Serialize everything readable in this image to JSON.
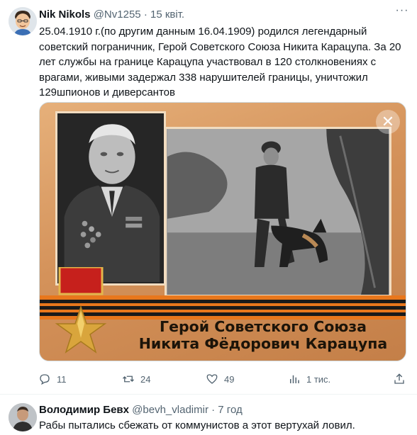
{
  "tweet": {
    "author_name": "Nik Nikols",
    "author_handle": "@Nv1255",
    "separator": "·",
    "date": "15 квіт.",
    "more_label": "···",
    "text": "25.04.1910 г.(по другим данным 16.04.1909) родился легендарный советский пограничник, Герой Советского Союза Никита Карацупа. За 20 лет службы на границе Карацупа участвовал в 120 столкновениях с врагами, живыми задержал 338 нарушителей границы, уничтожил 129шпионов и диверсантов",
    "image": {
      "caption_line1": "Герой Советского Союза",
      "caption_line2": "Никита Фёдорович Карацупа",
      "close_label": "✕"
    },
    "actions": {
      "replies": "11",
      "reposts": "24",
      "likes": "49",
      "views": "1 тис."
    }
  },
  "reply": {
    "author_name": "Володимир Бевх",
    "author_handle": "@bevh_vladimir",
    "separator": "·",
    "date": "7 год",
    "text": "Рабы пытались сбежать от коммунистов а этот вертухай ловил."
  },
  "colors": {
    "text_primary": "#0f1419",
    "text_secondary": "#536471",
    "divider": "#eff3f4",
    "image_bg": "#d59558",
    "ribbon_orange": "#e8771c",
    "ribbon_black": "#1a1a1a"
  },
  "icons": [
    "avatar-memoji",
    "more-icon",
    "close-icon",
    "reply-icon",
    "repost-icon",
    "like-icon",
    "views-icon",
    "share-icon"
  ]
}
